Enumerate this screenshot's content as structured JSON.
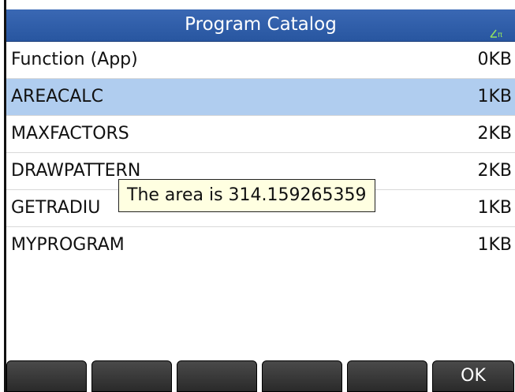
{
  "title": "Program Catalog",
  "status_icon": "angle-pi-icon",
  "programs": [
    {
      "name": "Function (App)",
      "size": "0KB"
    },
    {
      "name": "AREACALC",
      "size": "1KB"
    },
    {
      "name": "MAXFACTORS",
      "size": "2KB"
    },
    {
      "name": "DRAWPATTERN",
      "size": "2KB"
    },
    {
      "name": "GETRADIU",
      "size": "1KB"
    },
    {
      "name": "MYPROGRAM",
      "size": "1KB"
    }
  ],
  "selected_index": 1,
  "tooltip": "The area is 314.159265359",
  "softkeys": [
    "",
    "",
    "",
    "",
    "",
    "OK"
  ],
  "colors": {
    "titlebar": "#2f5faa",
    "selection": "#b0cdef",
    "tooltip_bg": "#ffffe1",
    "softkey": "#333333"
  }
}
